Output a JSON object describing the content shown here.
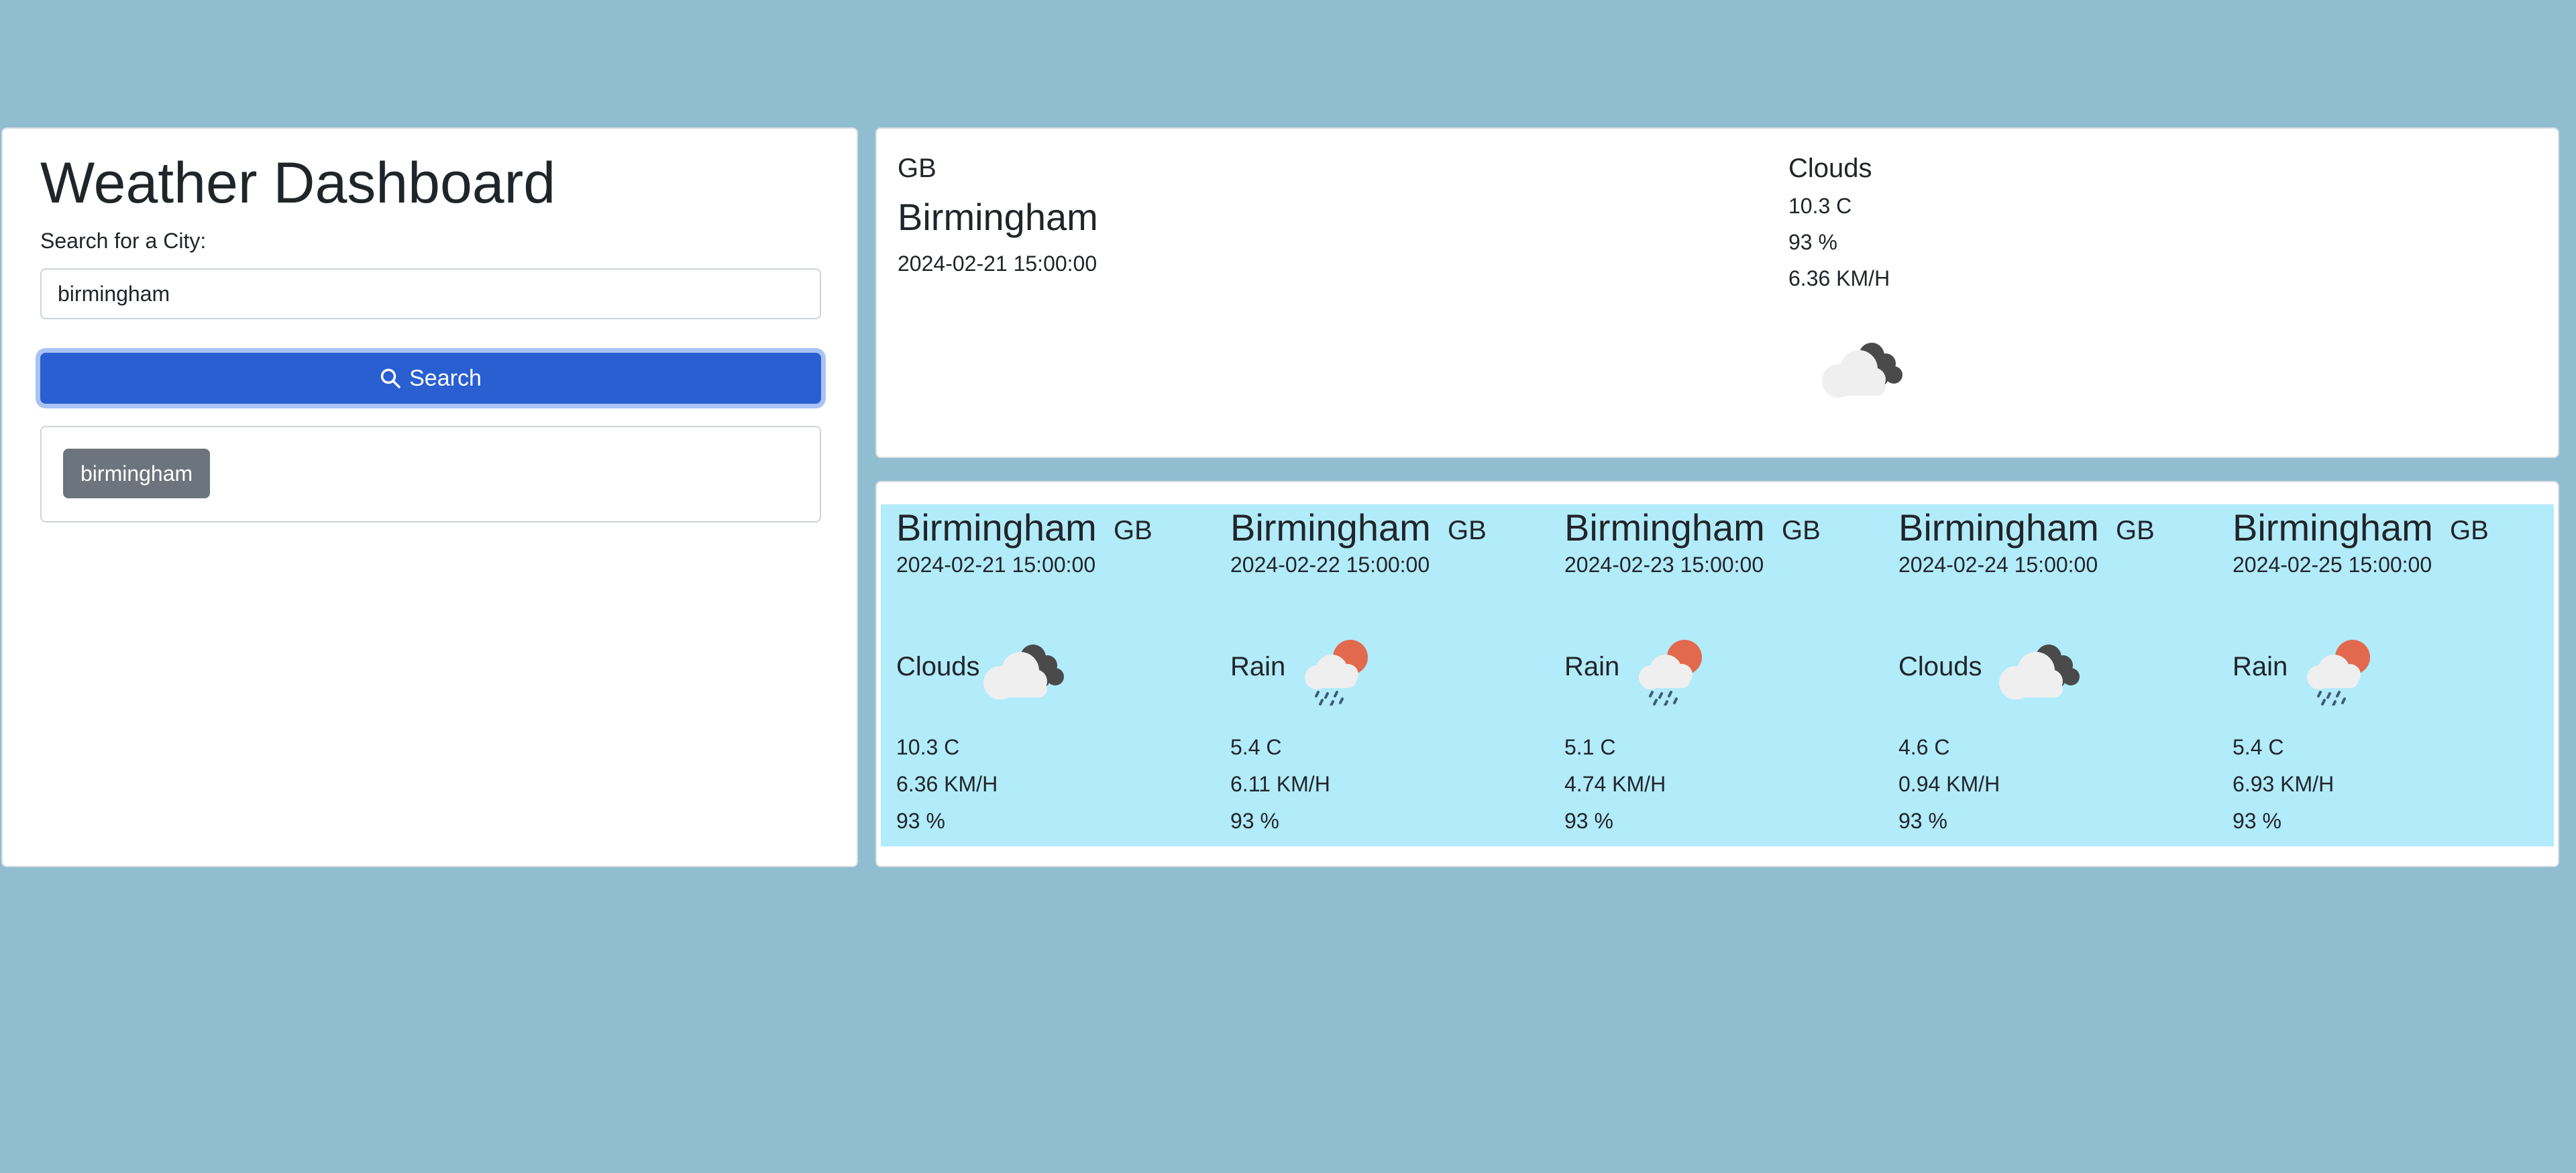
{
  "sidebar": {
    "title": "Weather Dashboard",
    "search_label": "Search for a City:",
    "search_value": "birmingham",
    "search_button_label": "Search",
    "history": [
      "birmingham"
    ]
  },
  "current": {
    "country": "GB",
    "city": "Birmingham",
    "datetime": "2024-02-21 15:00:00",
    "condition": "Clouds",
    "temperature": "10.3 C",
    "humidity": "93 %",
    "wind": "6.36 KM/H",
    "icon": "clouds-icon"
  },
  "forecast": [
    {
      "city": "Birmingham",
      "country": "GB",
      "datetime": "2024-02-21 15:00:00",
      "condition": "Clouds",
      "icon": "clouds-icon",
      "temperature": "10.3 C",
      "wind": "6.36 KM/H",
      "humidity": "93 %"
    },
    {
      "city": "Birmingham",
      "country": "GB",
      "datetime": "2024-02-22 15:00:00",
      "condition": "Rain",
      "icon": "rain-sun-icon",
      "temperature": "5.4 C",
      "wind": "6.11 KM/H",
      "humidity": "93 %"
    },
    {
      "city": "Birmingham",
      "country": "GB",
      "datetime": "2024-02-23 15:00:00",
      "condition": "Rain",
      "icon": "rain-sun-icon",
      "temperature": "5.1 C",
      "wind": "4.74 KM/H",
      "humidity": "93 %"
    },
    {
      "city": "Birmingham",
      "country": "GB",
      "datetime": "2024-02-24 15:00:00",
      "condition": "Clouds",
      "icon": "clouds-icon",
      "temperature": "4.6 C",
      "wind": "0.94 KM/H",
      "humidity": "93 %"
    },
    {
      "city": "Birmingham",
      "country": "GB",
      "datetime": "2024-02-25 15:00:00",
      "condition": "Rain",
      "icon": "rain-sun-icon",
      "temperature": "5.4 C",
      "wind": "6.93 KM/H",
      "humidity": "93 %"
    }
  ],
  "colors": {
    "page_background": "#91bdd1",
    "primary_button": "#2a5fd1",
    "history_button": "#6c757d",
    "forecast_background": "#b2ebf9",
    "sun": "#e2694d",
    "dark_cloud": "#4a4a4a",
    "light_cloud": "#efefef",
    "rain": "#3f5a74"
  }
}
